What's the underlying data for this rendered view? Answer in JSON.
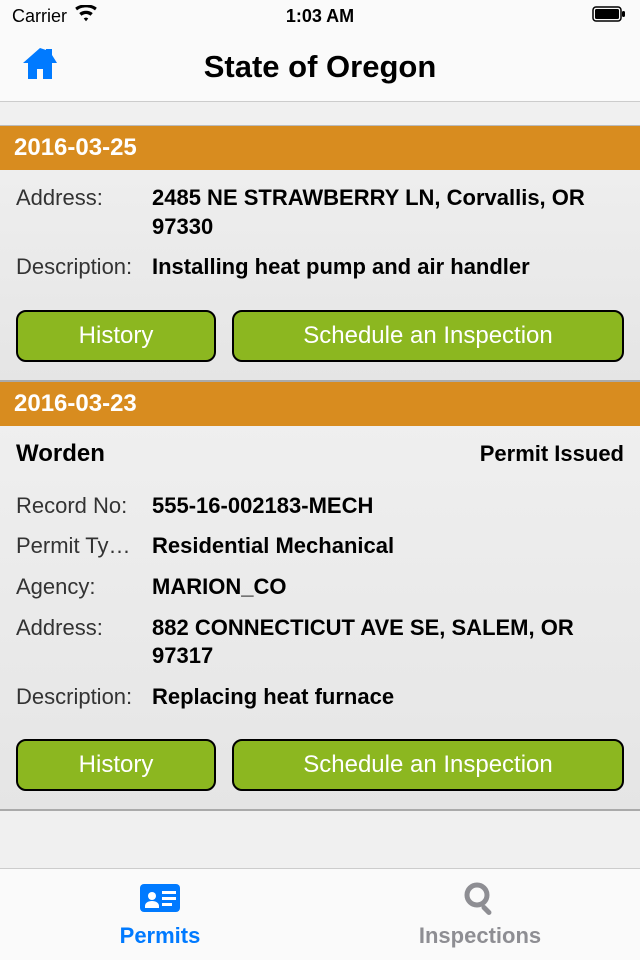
{
  "status_bar": {
    "carrier": "Carrier",
    "time": "1:03 AM"
  },
  "header": {
    "title": "State of Oregon"
  },
  "labels": {
    "address": "Address:",
    "description": "Description:",
    "record_no": "Record No:",
    "permit_type": "Permit Ty…",
    "agency": "Agency:",
    "history_btn": "History",
    "schedule_btn": "Schedule an Inspection"
  },
  "permits": [
    {
      "date": "2016-03-25",
      "address": "2485 NE STRAWBERRY LN, Corvallis, OR 97330",
      "description": "Installing heat pump and air handler"
    },
    {
      "date": "2016-03-23",
      "name": "Worden",
      "status": "Permit Issued",
      "record_no": "555-16-002183-MECH",
      "permit_type": "Residential Mechanical",
      "agency": "MARION_CO",
      "address": "882 CONNECTICUT AVE SE, SALEM, OR 97317",
      "description": "Replacing heat furnace"
    }
  ],
  "tabs": {
    "permits": "Permits",
    "inspections": "Inspections"
  }
}
